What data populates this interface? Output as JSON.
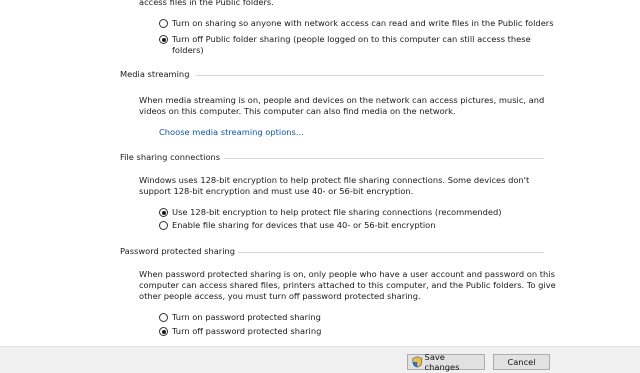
{
  "public_folder": {
    "intro_tail": "access files in the Public folders.",
    "options": [
      {
        "label": "Turn on sharing so anyone with network access can read and write files in the Public folders",
        "selected": false
      },
      {
        "label_line1": "Turn off Public folder sharing (people logged on to this computer can still access these",
        "label_line2": "folders)",
        "selected": true
      }
    ]
  },
  "media_streaming": {
    "title": "Media streaming",
    "desc_line1": "When media streaming is on, people and devices on the network can access pictures, music, and",
    "desc_line2": "videos on this computer. This computer can also find media on the network.",
    "link": "Choose media streaming options..."
  },
  "file_sharing": {
    "title": "File sharing connections",
    "desc_line1": "Windows uses 128-bit encryption to help protect file sharing connections. Some devices don't",
    "desc_line2": "support 128-bit encryption and must use 40- or 56-bit encryption.",
    "options": [
      {
        "label": "Use 128-bit encryption to help protect file sharing connections (recommended)",
        "selected": true
      },
      {
        "label": "Enable file sharing for devices that use 40- or 56-bit encryption",
        "selected": false
      }
    ]
  },
  "password_sharing": {
    "title": "Password protected sharing",
    "desc_line1": "When password protected sharing is on, only people who have a user account and password on this",
    "desc_line2": "computer can access shared files, printers attached to this computer, and the Public folders. To give",
    "desc_line3": "other people access, you must turn off password protected sharing.",
    "options": [
      {
        "label": "Turn on password protected sharing",
        "selected": false
      },
      {
        "label": "Turn off password protected sharing",
        "selected": true
      }
    ]
  },
  "footer": {
    "save_label": "Save changes",
    "cancel_label": "Cancel",
    "save_icon": "uac-shield-icon"
  }
}
